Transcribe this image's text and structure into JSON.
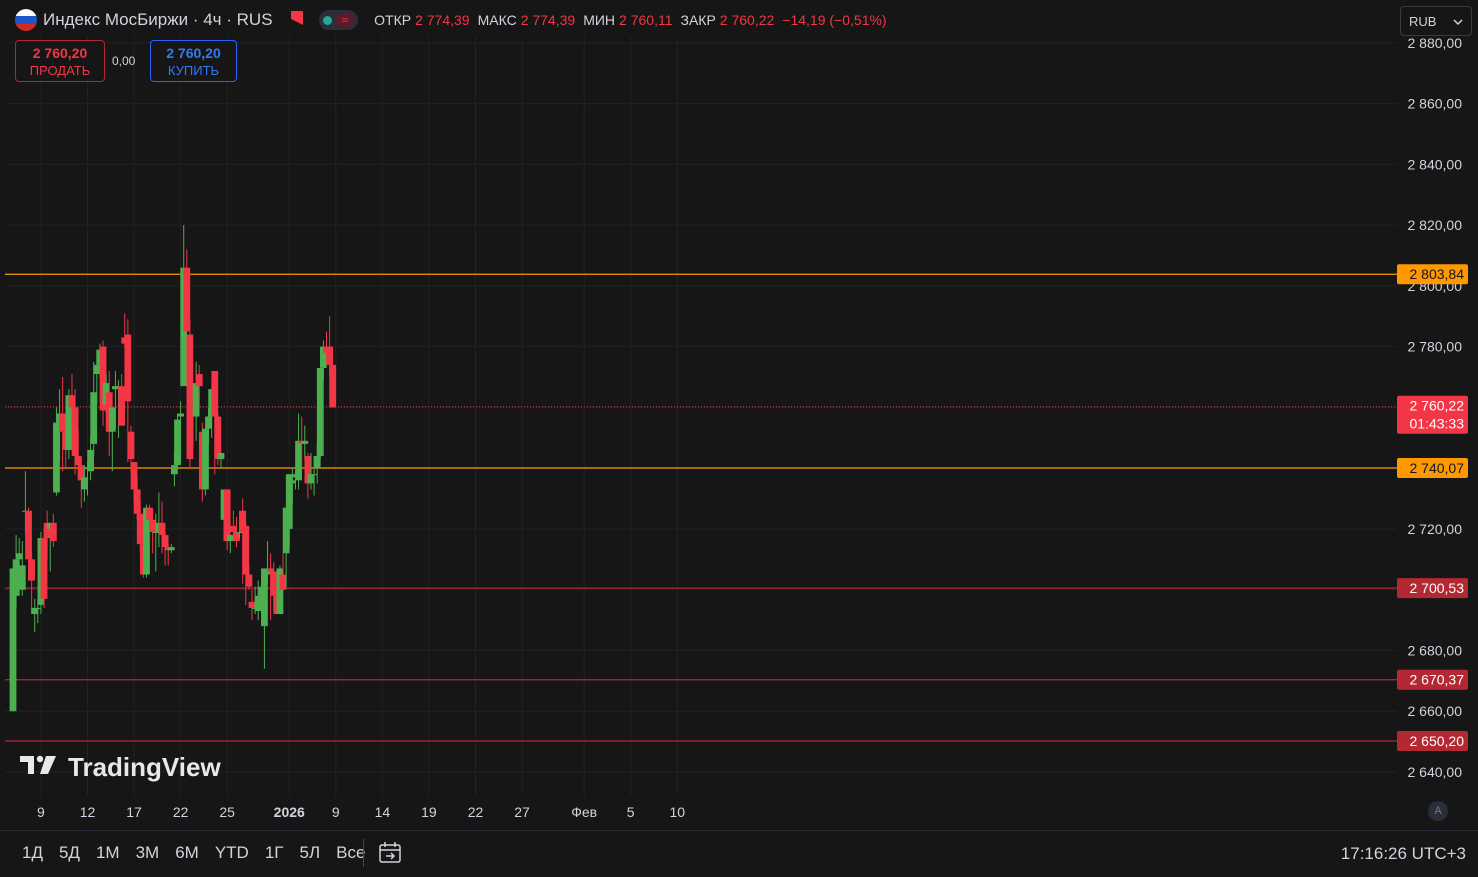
{
  "header": {
    "symbol": "Индекс МосБиржи · 4ч · RUS",
    "open_label": "ОТКР",
    "open": "2 774,39",
    "high_label": "МАКС",
    "high": "2 774,39",
    "low_label": "МИН",
    "low": "2 760,11",
    "close_label": "ЗАКР",
    "close": "2 760,22",
    "change": "−14,19 (−0,51%)"
  },
  "trade": {
    "sell_price": "2 760,20",
    "sell_label": "ПРОДАТЬ",
    "spread": "0,00",
    "buy_price": "2 760,20",
    "buy_label": "КУПИТЬ"
  },
  "currency": {
    "label": "RUB",
    "chevron_icon": "chevron-down-icon"
  },
  "brand": {
    "name": "TradingView",
    "logo_icon": "tradingview-logo-icon"
  },
  "bottom": {
    "ranges": [
      "1Д",
      "5Д",
      "1М",
      "3М",
      "6М",
      "YTD",
      "1Г",
      "5Л",
      "Все"
    ],
    "calendar_icon": "goto-date-icon",
    "time": "17:16:26 UTC+3"
  },
  "axis_badge": "A",
  "colors": {
    "up": "#4caf50",
    "down": "#f23645",
    "orange_line": "#ff9800",
    "red_line": "#b22833",
    "background": "#161616",
    "grid": "#222222"
  },
  "chart_data": {
    "type": "candlestick",
    "y_ticks": [
      "2 880,00",
      "2 860,00",
      "2 840,00",
      "2 820,00",
      "2 800,00",
      "2 780,00",
      "2 760,00",
      "2 740,00",
      "2 720,00",
      "2 700,00",
      "2 680,00",
      "2 660,00",
      "2 640,00"
    ],
    "y_tick_values": [
      2880,
      2860,
      2840,
      2820,
      2800,
      2780,
      2760,
      2740,
      2720,
      2700,
      2680,
      2660,
      2640
    ],
    "ylim": [
      2631.3,
      2882.0
    ],
    "x_ticks": [
      {
        "label": "9",
        "index": 9
      },
      {
        "label": "12",
        "index": 24
      },
      {
        "label": "17",
        "index": 39
      },
      {
        "label": "22",
        "index": 54
      },
      {
        "label": "25",
        "index": 69
      },
      {
        "label": "2026",
        "index": 89,
        "bold": true
      },
      {
        "label": "9",
        "index": 104
      },
      {
        "label": "14",
        "index": 119
      },
      {
        "label": "19",
        "index": 134
      },
      {
        "label": "22",
        "index": 149
      },
      {
        "label": "27",
        "index": 164
      },
      {
        "label": "Фев",
        "index": 184
      },
      {
        "label": "5",
        "index": 199
      },
      {
        "label": "10",
        "index": 214
      }
    ],
    "levels": [
      {
        "label": "2 803,84",
        "value": 2803.84,
        "color": "#ff9800",
        "text_color": "#131722"
      },
      {
        "label": "2 740,07",
        "value": 2740.07,
        "color": "#ff9800",
        "text_color": "#131722"
      },
      {
        "label": "2 700,53",
        "value": 2700.53,
        "color": "#b22833",
        "text_color": "#ffffff"
      },
      {
        "label": "2 670,37",
        "value": 2670.37,
        "color": "#b22833",
        "text_color": "#ffffff"
      },
      {
        "label": "2 650,20",
        "value": 2650.2,
        "color": "#b22833",
        "text_color": "#ffffff"
      }
    ],
    "last_price": {
      "label": "2 760,22",
      "countdown": "01:43:33",
      "value": 2760.22,
      "color": "#f23645"
    },
    "candles": [
      {
        "o": 2660,
        "h": 2705,
        "l": 2660,
        "c": 2707
      },
      {
        "o": 2698,
        "h": 2718,
        "l": 2694,
        "c": 2710
      },
      {
        "o": 2710,
        "h": 2717,
        "l": 2698,
        "c": 2712
      },
      {
        "o": 2700,
        "h": 2716,
        "l": 2698,
        "c": 2708
      },
      {
        "o": 2726,
        "h": 2739,
        "l": 2718,
        "c": 2726
      },
      {
        "o": 2726,
        "h": 2727,
        "l": 2703,
        "c": 2710
      },
      {
        "o": 2710,
        "h": 2713,
        "l": 2692,
        "c": 2703
      },
      {
        "o": 2692,
        "h": 2697,
        "l": 2686,
        "c": 2694
      },
      {
        "o": 2694,
        "h": 2697,
        "l": 2689,
        "c": 2694
      },
      {
        "o": 2695,
        "h": 2719,
        "l": 2692,
        "c": 2717
      },
      {
        "o": 2717,
        "h": 2720,
        "l": 2694,
        "c": 2697
      },
      {
        "o": 2722,
        "h": 2726,
        "l": 2710,
        "c": 2717
      },
      {
        "o": 2720,
        "h": 2722,
        "l": 2706,
        "c": 2722
      },
      {
        "o": 2722,
        "h": 2725,
        "l": 2714,
        "c": 2716
      },
      {
        "o": 2732,
        "h": 2760,
        "l": 2731,
        "c": 2755
      },
      {
        "o": 2755,
        "h": 2766,
        "l": 2742,
        "c": 2758
      },
      {
        "o": 2758,
        "h": 2770,
        "l": 2739,
        "c": 2752
      },
      {
        "o": 2752,
        "h": 2756,
        "l": 2740,
        "c": 2746
      },
      {
        "o": 2746,
        "h": 2766,
        "l": 2743,
        "c": 2764
      },
      {
        "o": 2764,
        "h": 2771,
        "l": 2754,
        "c": 2760
      },
      {
        "o": 2760,
        "h": 2766,
        "l": 2738,
        "c": 2744
      },
      {
        "o": 2744,
        "h": 2753,
        "l": 2736,
        "c": 2741
      },
      {
        "o": 2741,
        "h": 2744,
        "l": 2727,
        "c": 2736
      },
      {
        "o": 2733,
        "h": 2741,
        "l": 2729,
        "c": 2737
      },
      {
        "o": 2740,
        "h": 2742,
        "l": 2731,
        "c": 2740
      },
      {
        "o": 2739,
        "h": 2750,
        "l": 2736,
        "c": 2746
      },
      {
        "o": 2748,
        "h": 2775,
        "l": 2744,
        "c": 2765
      },
      {
        "o": 2771,
        "h": 2779,
        "l": 2761,
        "c": 2774
      },
      {
        "o": 2774,
        "h": 2781,
        "l": 2770,
        "c": 2779
      },
      {
        "o": 2780,
        "h": 2782,
        "l": 2754,
        "c": 2759
      },
      {
        "o": 2761,
        "h": 2771,
        "l": 2758,
        "c": 2768
      },
      {
        "o": 2765,
        "h": 2772,
        "l": 2744,
        "c": 2752
      },
      {
        "o": 2752,
        "h": 2760,
        "l": 2739,
        "c": 2760
      },
      {
        "o": 2766,
        "h": 2772,
        "l": 2753,
        "c": 2767
      },
      {
        "o": 2767,
        "h": 2769,
        "l": 2750,
        "c": 2767
      },
      {
        "o": 2767,
        "h": 2771,
        "l": 2755,
        "c": 2754
      },
      {
        "o": 2783,
        "h": 2791,
        "l": 2780,
        "c": 2781
      },
      {
        "o": 2784,
        "h": 2789,
        "l": 2742,
        "c": 2762
      },
      {
        "o": 2752,
        "h": 2754,
        "l": 2739,
        "c": 2743
      },
      {
        "o": 2742,
        "h": 2742,
        "l": 2729,
        "c": 2733
      },
      {
        "o": 2733,
        "h": 2737,
        "l": 2723,
        "c": 2725
      },
      {
        "o": 2725,
        "h": 2729,
        "l": 2712,
        "c": 2715
      },
      {
        "o": 2715,
        "h": 2719,
        "l": 2704,
        "c": 2705
      },
      {
        "o": 2705,
        "h": 2728,
        "l": 2704,
        "c": 2727
      },
      {
        "o": 2727,
        "h": 2728,
        "l": 2715,
        "c": 2723
      },
      {
        "o": 2723,
        "h": 2726,
        "l": 2712,
        "c": 2719
      },
      {
        "o": 2719,
        "h": 2725,
        "l": 2706,
        "c": 2719
      },
      {
        "o": 2719,
        "h": 2732,
        "l": 2714,
        "c": 2722
      },
      {
        "o": 2722,
        "h": 2729,
        "l": 2712,
        "c": 2718
      },
      {
        "o": 2718,
        "h": 2719,
        "l": 2708,
        "c": 2714
      },
      {
        "o": 2714,
        "h": 2715,
        "l": 2708,
        "c": 2713
      },
      {
        "o": 2713,
        "h": 2715,
        "l": 2712,
        "c": 2714
      },
      {
        "o": 2738,
        "h": 2745,
        "l": 2734,
        "c": 2741
      },
      {
        "o": 2741,
        "h": 2758,
        "l": 2740,
        "c": 2756
      },
      {
        "o": 2757,
        "h": 2762,
        "l": 2742,
        "c": 2758
      },
      {
        "o": 2767,
        "h": 2820,
        "l": 2768,
        "c": 2806
      },
      {
        "o": 2806,
        "h": 2812,
        "l": 2792,
        "c": 2785
      },
      {
        "o": 2784,
        "h": 2789,
        "l": 2740,
        "c": 2743
      },
      {
        "o": 2760,
        "h": 2764,
        "l": 2747,
        "c": 2757
      },
      {
        "o": 2757,
        "h": 2775,
        "l": 2749,
        "c": 2768
      },
      {
        "o": 2771,
        "h": 2774,
        "l": 2761,
        "c": 2767
      },
      {
        "o": 2752,
        "h": 2755,
        "l": 2729,
        "c": 2733
      },
      {
        "o": 2733,
        "h": 2754,
        "l": 2731,
        "c": 2753
      },
      {
        "o": 2753,
        "h": 2760,
        "l": 2748,
        "c": 2757
      },
      {
        "o": 2757,
        "h": 2766,
        "l": 2750,
        "c": 2766
      },
      {
        "o": 2772,
        "h": 2767,
        "l": 2738,
        "c": 2757
      },
      {
        "o": 2757,
        "h": 2758,
        "l": 2741,
        "c": 2743
      },
      {
        "o": 2743,
        "h": 2745,
        "l": 2740,
        "c": 2745
      },
      {
        "o": 2723,
        "h": 2732,
        "l": 2716,
        "c": 2733
      },
      {
        "o": 2733,
        "h": 2731,
        "l": 2713,
        "c": 2716
      },
      {
        "o": 2716,
        "h": 2718,
        "l": 2712,
        "c": 2718
      },
      {
        "o": 2721,
        "h": 2726,
        "l": 2716,
        "c": 2719
      },
      {
        "o": 2719,
        "h": 2724,
        "l": 2714,
        "c": 2716
      },
      {
        "o": 2719,
        "h": 2726,
        "l": 2717,
        "c": 2719
      },
      {
        "o": 2726,
        "h": 2730,
        "l": 2702,
        "c": 2719
      },
      {
        "o": 2721,
        "h": 2722,
        "l": 2695,
        "c": 2705
      },
      {
        "o": 2705,
        "h": 2708,
        "l": 2700,
        "c": 2701
      },
      {
        "o": 2696,
        "h": 2700,
        "l": 2690,
        "c": 2694
      },
      {
        "o": 2694,
        "h": 2701,
        "l": 2692,
        "c": 2694
      },
      {
        "o": 2693,
        "h": 2703,
        "l": 2690,
        "c": 2698
      },
      {
        "o": 2698,
        "h": 2701,
        "l": 2694,
        "c": 2701
      },
      {
        "o": 2688,
        "h": 2707,
        "l": 2674,
        "c": 2707
      },
      {
        "o": 2705,
        "h": 2716,
        "l": 2702,
        "c": 2707
      },
      {
        "o": 2707,
        "h": 2712,
        "l": 2690,
        "c": 2706
      },
      {
        "o": 2706,
        "h": 2709,
        "l": 2693,
        "c": 2698
      },
      {
        "o": 2698,
        "h": 2702,
        "l": 2692,
        "c": 2692
      },
      {
        "o": 2692,
        "h": 2708,
        "l": 2692,
        "c": 2707
      },
      {
        "o": 2705,
        "h": 2712,
        "l": 2702,
        "c": 2700
      },
      {
        "o": 2712,
        "h": 2715,
        "l": 2701,
        "c": 2727
      },
      {
        "o": 2720,
        "h": 2735,
        "l": 2714,
        "c": 2738
      },
      {
        "o": 2735,
        "h": 2740,
        "l": 2728,
        "c": 2736
      },
      {
        "o": 2737,
        "h": 2739,
        "l": 2733,
        "c": 2738
      },
      {
        "o": 2736,
        "h": 2758,
        "l": 2733,
        "c": 2749
      },
      {
        "o": 2749,
        "h": 2757,
        "l": 2740,
        "c": 2748
      },
      {
        "o": 2748,
        "h": 2754,
        "l": 2743,
        "c": 2749
      },
      {
        "o": 2744,
        "h": 2745,
        "l": 2730,
        "c": 2735
      },
      {
        "o": 2735,
        "h": 2745,
        "l": 2733,
        "c": 2738
      },
      {
        "o": 2738,
        "h": 2744,
        "l": 2731,
        "c": 2738
      },
      {
        "o": 2740,
        "h": 2748,
        "l": 2735,
        "c": 2744
      },
      {
        "o": 2744,
        "h": 2770,
        "l": 2743,
        "c": 2773
      },
      {
        "o": 2773,
        "h": 2782,
        "l": 2769,
        "c": 2780
      },
      {
        "o": 2780,
        "h": 2785,
        "l": 2777,
        "c": 2778
      },
      {
        "o": 2780,
        "h": 2790,
        "l": 2770,
        "c": 2774
      },
      {
        "o": 2774,
        "h": 2774,
        "l": 2760,
        "c": 2760
      }
    ]
  }
}
